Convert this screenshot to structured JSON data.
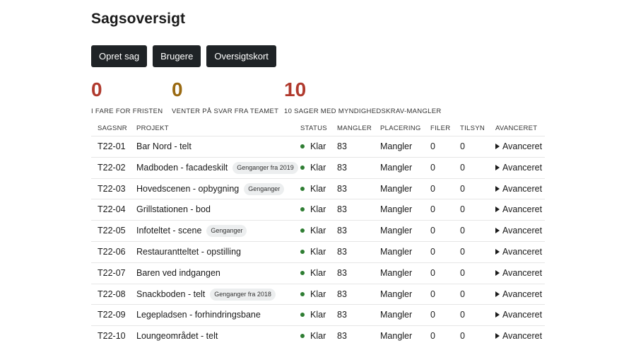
{
  "page": {
    "title": "Sagsoversigt"
  },
  "actions": [
    {
      "label": "Opret sag",
      "name": "opret-sag-button"
    },
    {
      "label": "Brugere",
      "name": "brugere-button"
    },
    {
      "label": "Oversigtskort",
      "name": "oversigtskort-button"
    }
  ],
  "stats": [
    {
      "value": "0",
      "label": "I FARE FOR FRISTEN",
      "color": "#b03a2e"
    },
    {
      "value": "0",
      "label": "VENTER PÅ SVAR FRA TEAMET",
      "color": "#9a6a12"
    },
    {
      "value": "10",
      "label": "10 SAGER MED MYNDIGHEDSKRAV-MANGLER",
      "color": "#b03a2e"
    }
  ],
  "table": {
    "headers": [
      "SAGSNR",
      "PROJEKT",
      "STATUS",
      "MANGLER",
      "PLACERING",
      "FILER",
      "TILSYN",
      "AVANCERET"
    ],
    "status_color": "#2e7d32",
    "rows": [
      {
        "nr": "T22-01",
        "project": "Bar Nord - telt",
        "tag": "",
        "status": "Klar",
        "mangler": "83",
        "placering": "Mangler",
        "filer": "0",
        "tilsyn": "0",
        "advanced": "Avanceret"
      },
      {
        "nr": "T22-02",
        "project": "Madboden - facadeskilt",
        "tag": "Genganger fra 2019",
        "status": "Klar",
        "mangler": "83",
        "placering": "Mangler",
        "filer": "0",
        "tilsyn": "0",
        "advanced": "Avanceret"
      },
      {
        "nr": "T22-03",
        "project": "Hovedscenen - opbygning",
        "tag": "Genganger",
        "status": "Klar",
        "mangler": "83",
        "placering": "Mangler",
        "filer": "0",
        "tilsyn": "0",
        "advanced": "Avanceret"
      },
      {
        "nr": "T22-04",
        "project": "Grillstationen - bod",
        "tag": "",
        "status": "Klar",
        "mangler": "83",
        "placering": "Mangler",
        "filer": "0",
        "tilsyn": "0",
        "advanced": "Avanceret"
      },
      {
        "nr": "T22-05",
        "project": "Infoteltet - scene",
        "tag": "Genganger",
        "status": "Klar",
        "mangler": "83",
        "placering": "Mangler",
        "filer": "0",
        "tilsyn": "0",
        "advanced": "Avanceret"
      },
      {
        "nr": "T22-06",
        "project": "Restaurantteltet - opstilling",
        "tag": "",
        "status": "Klar",
        "mangler": "83",
        "placering": "Mangler",
        "filer": "0",
        "tilsyn": "0",
        "advanced": "Avanceret"
      },
      {
        "nr": "T22-07",
        "project": "Baren ved indgangen",
        "tag": "",
        "status": "Klar",
        "mangler": "83",
        "placering": "Mangler",
        "filer": "0",
        "tilsyn": "0",
        "advanced": "Avanceret"
      },
      {
        "nr": "T22-08",
        "project": "Snackboden - telt",
        "tag": "Genganger fra 2018",
        "status": "Klar",
        "mangler": "83",
        "placering": "Mangler",
        "filer": "0",
        "tilsyn": "0",
        "advanced": "Avanceret"
      },
      {
        "nr": "T22-09",
        "project": "Legepladsen - forhindringsbane",
        "tag": "",
        "status": "Klar",
        "mangler": "83",
        "placering": "Mangler",
        "filer": "0",
        "tilsyn": "0",
        "advanced": "Avanceret"
      },
      {
        "nr": "T22-10",
        "project": "Loungeområdet - telt",
        "tag": "",
        "status": "Klar",
        "mangler": "83",
        "placering": "Mangler",
        "filer": "0",
        "tilsyn": "0",
        "advanced": "Avanceret"
      }
    ]
  }
}
